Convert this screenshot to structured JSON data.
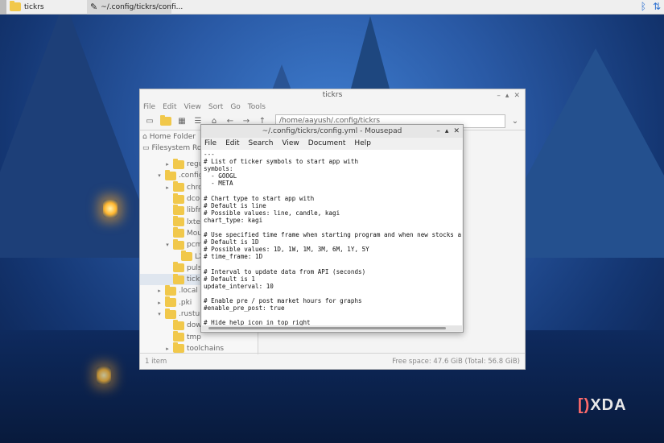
{
  "taskbar": {
    "apps": [
      {
        "label": "tickrs",
        "icon": "folder-icon"
      },
      {
        "label": "~/.config/tickrs/confi...",
        "icon": "text-editor-icon"
      }
    ],
    "tray_icons": [
      "bluetooth-icon",
      "network-icon"
    ]
  },
  "file_manager": {
    "title": "tickrs",
    "menu": [
      "File",
      "Edit",
      "View",
      "Sort",
      "Go",
      "Tools"
    ],
    "path": "/home/aayush/.config/tickrs",
    "places": [
      "Home Folder",
      "Filesystem Root"
    ],
    "tree": [
      {
        "label": "regu",
        "indent": 3,
        "arrow": "▸"
      },
      {
        "label": ".config",
        "indent": 2,
        "arrow": "▾"
      },
      {
        "label": "chro",
        "indent": 3,
        "arrow": "▸"
      },
      {
        "label": "dcon",
        "indent": 3,
        "arrow": ""
      },
      {
        "label": "libfm",
        "indent": 3,
        "arrow": ""
      },
      {
        "label": "lxter",
        "indent": 3,
        "arrow": ""
      },
      {
        "label": "Mou",
        "indent": 3,
        "arrow": ""
      },
      {
        "label": "pcm",
        "indent": 3,
        "arrow": "▾"
      },
      {
        "label": "LX",
        "indent": 4,
        "arrow": ""
      },
      {
        "label": "pulse",
        "indent": 3,
        "arrow": ""
      },
      {
        "label": "tickr",
        "indent": 3,
        "arrow": "",
        "selected": true
      },
      {
        "label": ".local",
        "indent": 2,
        "arrow": "▸"
      },
      {
        "label": ".pki",
        "indent": 2,
        "arrow": "▸"
      },
      {
        "label": ".rustup",
        "indent": 2,
        "arrow": "▾"
      },
      {
        "label": "dowr",
        "indent": 3,
        "arrow": ""
      },
      {
        "label": "tmp",
        "indent": 3,
        "arrow": ""
      },
      {
        "label": "toolchains",
        "indent": 3,
        "arrow": "▸"
      }
    ],
    "status_left": "1 item",
    "status_right": "Free space: 47.6 GiB (Total: 56.8 GiB)"
  },
  "mousepad": {
    "title": "~/.config/tickrs/config.yml - Mousepad",
    "menu": [
      "File",
      "Edit",
      "Search",
      "View",
      "Document",
      "Help"
    ],
    "lines": [
      "---",
      "# List of ticker symbols to start app with",
      "symbols:",
      "  - GOOGL",
      "  - META",
      "",
      "# Chart type to start app with",
      "# Default is line",
      "# Possible values: line, candle, kagi",
      "chart_type: kagi",
      "",
      "# Use specified time frame when starting program and when new stocks ar",
      "# Default is 1D",
      "# Possible values: 1D, 1W, 1M, 3M, 6M, 1Y, 5Y",
      "# time_frame: 1D",
      "",
      "# Interval to update data from API (seconds)",
      "# Default is 1",
      "update_interval: 10",
      "",
      "# Enable pre / post market hours for graphs",
      "#enable_pre_post: true",
      "",
      "# Hide help icon in top right"
    ]
  },
  "watermark": "XDA"
}
